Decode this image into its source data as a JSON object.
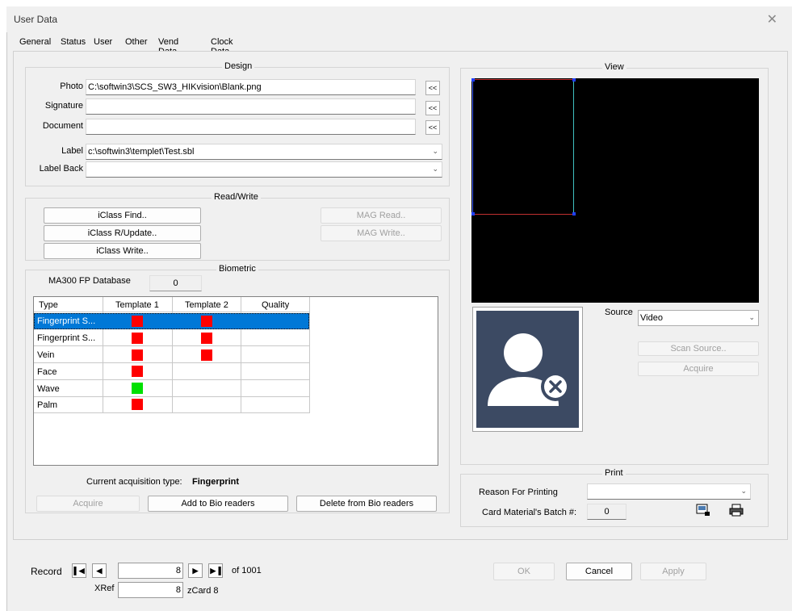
{
  "window": {
    "title": "User Data",
    "close_glyph": "✕"
  },
  "tabs": [
    "General",
    "Status",
    "User",
    "Other",
    "Vend Data",
    "Clock Data"
  ],
  "design": {
    "legend": "Design",
    "photo_label": "Photo",
    "photo_value": "C:\\softwin3\\SCS_SW3_HIKvision\\Blank.png",
    "signature_label": "Signature",
    "signature_value": "",
    "document_label": "Document",
    "document_value": "",
    "browse_label": "<<",
    "label_label": "Label",
    "label_value": "c:\\softwin3\\templet\\Test.sbl",
    "labelback_label": "Label Back",
    "labelback_value": ""
  },
  "readwrite": {
    "legend": "Read/Write",
    "iclass_find": "iClass Find..",
    "iclass_rupdate": "iClass R/Update..",
    "iclass_write": "iClass Write..",
    "mag_read": "MAG Read..",
    "mag_write": "MAG Write.."
  },
  "biometric": {
    "legend": "Biometric",
    "db_label": "MA300 FP Database",
    "db_value": "0",
    "columns": [
      "Type",
      "Template 1",
      "Template 2",
      "Quality"
    ],
    "rows": [
      {
        "type": "Fingerprint S...",
        "t1": "red",
        "t2": "red",
        "quality": ""
      },
      {
        "type": "Fingerprint S...",
        "t1": "red",
        "t2": "red",
        "quality": ""
      },
      {
        "type": "Vein",
        "t1": "red",
        "t2": "red",
        "quality": ""
      },
      {
        "type": "Face",
        "t1": "red",
        "t2": "",
        "quality": ""
      },
      {
        "type": "Wave",
        "t1": "green",
        "t2": "",
        "quality": ""
      },
      {
        "type": "Palm",
        "t1": "red",
        "t2": "",
        "quality": ""
      }
    ],
    "acq_label": "Current acquisition type:",
    "acq_value": "Fingerprint",
    "acquire": "Acquire",
    "add": "Add to Bio readers",
    "delete": "Delete from Bio readers"
  },
  "view": {
    "legend": "View",
    "source_label": "Source",
    "source_value": "Video",
    "scan_source": "Scan Source..",
    "acquire": "Acquire"
  },
  "print": {
    "legend": "Print",
    "reason_label": "Reason For Printing",
    "reason_value": "",
    "batch_label": "Card Material's Batch #:",
    "batch_value": "0"
  },
  "footer": {
    "record_label": "Record",
    "record_value": "8",
    "of_text": "of 1001",
    "xref_label": "XRef",
    "xref_value": "8",
    "zcard_text": "zCard 8",
    "ok": "OK",
    "cancel": "Cancel",
    "apply": "Apply"
  },
  "colors": {
    "red": "#ff0000",
    "green": "#00e000",
    "selection": "#0078d7",
    "avatar_bg": "#3c4a63"
  }
}
